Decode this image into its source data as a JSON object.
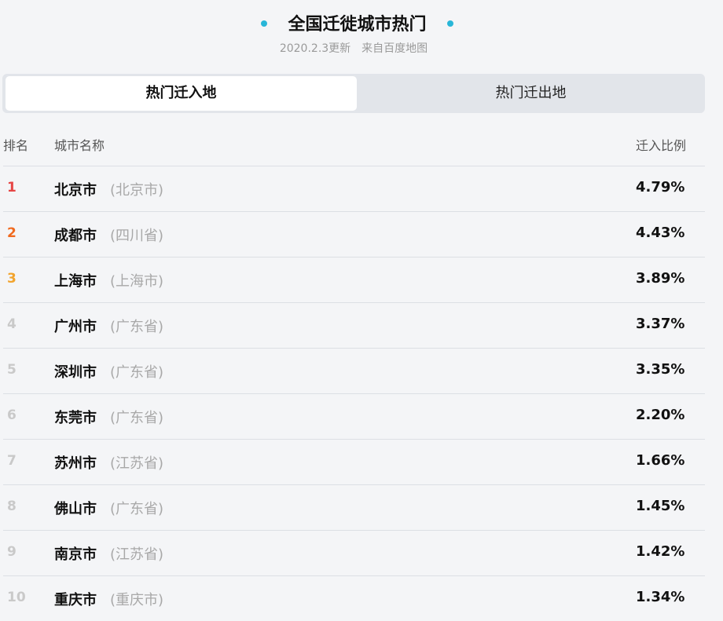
{
  "header": {
    "title": "全国迁徙城市热门",
    "update": "2020.2.3更新",
    "source": "来自百度地图",
    "accent_color": "#28b6d8"
  },
  "tabs": [
    {
      "label": "热门迁入地",
      "active": true
    },
    {
      "label": "热门迁出地",
      "active": false
    }
  ],
  "table": {
    "columns": {
      "rank": "排名",
      "city": "城市名称",
      "ratio": "迁入比例"
    },
    "rows": [
      {
        "rank": "1",
        "city": "北京市",
        "province": "(北京市)",
        "ratio": "4.79%"
      },
      {
        "rank": "2",
        "city": "成都市",
        "province": "(四川省)",
        "ratio": "4.43%"
      },
      {
        "rank": "3",
        "city": "上海市",
        "province": "(上海市)",
        "ratio": "3.89%"
      },
      {
        "rank": "4",
        "city": "广州市",
        "province": "(广东省)",
        "ratio": "3.37%"
      },
      {
        "rank": "5",
        "city": "深圳市",
        "province": "(广东省)",
        "ratio": "3.35%"
      },
      {
        "rank": "6",
        "city": "东莞市",
        "province": "(广东省)",
        "ratio": "2.20%"
      },
      {
        "rank": "7",
        "city": "苏州市",
        "province": "(江苏省)",
        "ratio": "1.66%"
      },
      {
        "rank": "8",
        "city": "佛山市",
        "province": "(广东省)",
        "ratio": "1.45%"
      },
      {
        "rank": "9",
        "city": "南京市",
        "province": "(江苏省)",
        "ratio": "1.42%"
      },
      {
        "rank": "10",
        "city": "重庆市",
        "province": "(重庆市)",
        "ratio": "1.34%"
      }
    ],
    "rank_colors": {
      "1": "#e64545",
      "2": "#f06a1f",
      "3": "#f2a42d",
      "other": "#c9c9c9"
    }
  }
}
